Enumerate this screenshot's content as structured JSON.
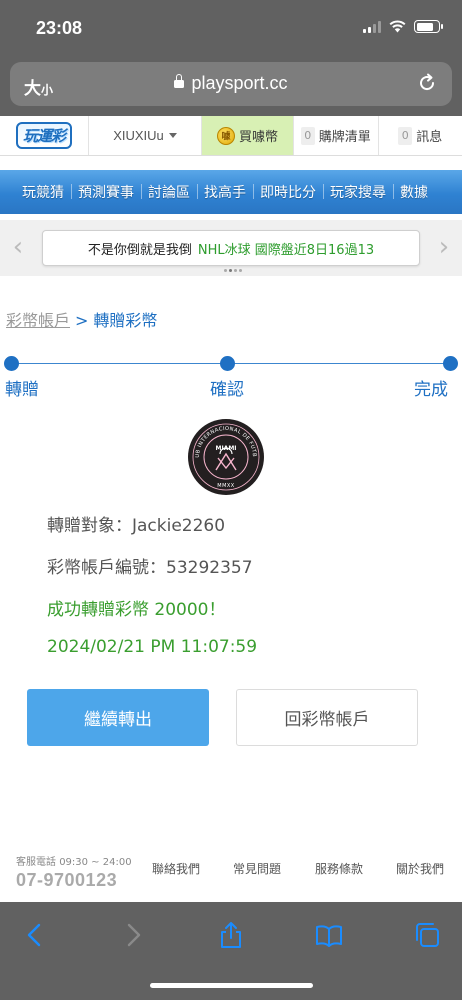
{
  "status_bar": {
    "time": "23:08"
  },
  "browser": {
    "text_size_button": "大小",
    "text_size_small": "小",
    "text_size_big": "大",
    "url": "playsport.cc"
  },
  "site_header": {
    "logo_text": "玩運彩",
    "username": "XIUXIUu",
    "buy_coins_label": "買噱幣",
    "coin_icon_text": "噱",
    "purchase_list_count": "0",
    "purchase_list_label": "購牌清單",
    "messages_count": "0",
    "messages_label": "訊息"
  },
  "main_nav": {
    "items": [
      "玩競猜",
      "預測賽事",
      "討論區",
      "找高手",
      "即時比分",
      "玩家搜尋",
      "數據"
    ]
  },
  "ticker": {
    "text_black": "不是你倒就是我倒",
    "text_green": "NHL冰球 國際盤近8日16過13"
  },
  "breadcrumb": {
    "parent": "彩幣帳戶",
    "separator": ">",
    "current": "轉贈彩幣"
  },
  "steps": [
    {
      "label": "轉贈"
    },
    {
      "label": "確認"
    },
    {
      "label": "完成"
    }
  ],
  "club_badge": {
    "top_text": "CLUB INTERNACIONAL DE FUTBOL",
    "center_text": "MIAMI",
    "bottom_text": "MMXX",
    "colors": {
      "ring": "#231f20",
      "accent": "#f7b5cd",
      "text": "#ffffff"
    }
  },
  "result": {
    "recipient_label": "轉贈對象：",
    "recipient_value": "Jackie2260",
    "account_label": "彩幣帳戶編號：",
    "account_value": "53292357",
    "success_message": "成功轉贈彩幣 20000！",
    "timestamp": "2024/02/21 PM 11:07:59"
  },
  "buttons": {
    "continue_label": "繼續轉出",
    "back_label": "回彩幣帳戶"
  },
  "footer": {
    "service_label": "客服電話",
    "service_hours": "09:30 ~ 24:00",
    "phone": "07-9700123",
    "links": [
      "聯絡我們",
      "常見問題",
      "服務條款",
      "關於我們"
    ]
  },
  "colors": {
    "chrome_gray": "#616161",
    "nav_blue": "#2f82d2",
    "step_blue": "#1f70c3",
    "success_green": "#3a9e2f",
    "primary_button": "#4da6ea",
    "coin_highlight": "#d8f0b4"
  }
}
